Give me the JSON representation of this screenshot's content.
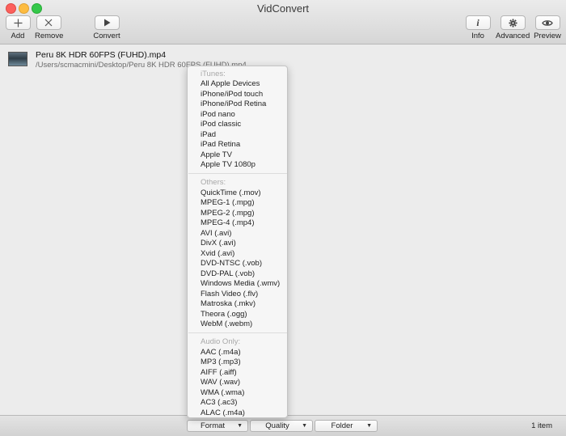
{
  "window": {
    "title": "VidConvert"
  },
  "toolbar": {
    "add": {
      "label": "Add",
      "icon": "plus-icon"
    },
    "remove": {
      "label": "Remove",
      "icon": "x-icon"
    },
    "convert": {
      "label": "Convert",
      "icon": "play-icon"
    },
    "info": {
      "label": "Info",
      "icon": "info-icon"
    },
    "advanced": {
      "label": "Advanced",
      "icon": "gear-icon"
    },
    "preview": {
      "label": "Preview",
      "icon": "eye-icon"
    }
  },
  "files": [
    {
      "name": "Peru 8K HDR 60FPS (FUHD).mp4",
      "path": "/Users/scmacmini/Desktop/Peru 8K HDR 60FPS (FUHD).mp4"
    }
  ],
  "format_menu": {
    "sections": [
      {
        "header": "iTunes:",
        "items": [
          "All Apple Devices",
          "iPhone/iPod touch",
          "iPhone/iPod Retina",
          "iPod nano",
          "iPod classic",
          "iPad",
          "iPad Retina",
          "Apple TV",
          "Apple TV 1080p"
        ]
      },
      {
        "header": "Others:",
        "items": [
          "QuickTime (.mov)",
          "MPEG-1 (.mpg)",
          "MPEG-2 (.mpg)",
          "MPEG-4 (.mp4)",
          "AVI (.avi)",
          "DivX (.avi)",
          "Xvid (.avi)",
          "DVD-NTSC (.vob)",
          "DVD-PAL (.vob)",
          "Windows Media (.wmv)",
          "Flash Video (.flv)",
          "Matroska (.mkv)",
          "Theora (.ogg)",
          "WebM (.webm)"
        ]
      },
      {
        "header": "Audio Only:",
        "items": [
          "AAC (.m4a)",
          "MP3 (.mp3)",
          "AIFF (.aiff)",
          "WAV (.wav)",
          "WMA (.wma)",
          "AC3 (.ac3)",
          "ALAC (.m4a)"
        ]
      }
    ]
  },
  "bottombar": {
    "format_label": "Format",
    "quality_label": "Quality",
    "folder_label": "Folder",
    "items_count": "1 item"
  },
  "colors": {
    "close": "#fc605c",
    "minimize": "#fdbc40",
    "maximize": "#34c84a"
  }
}
